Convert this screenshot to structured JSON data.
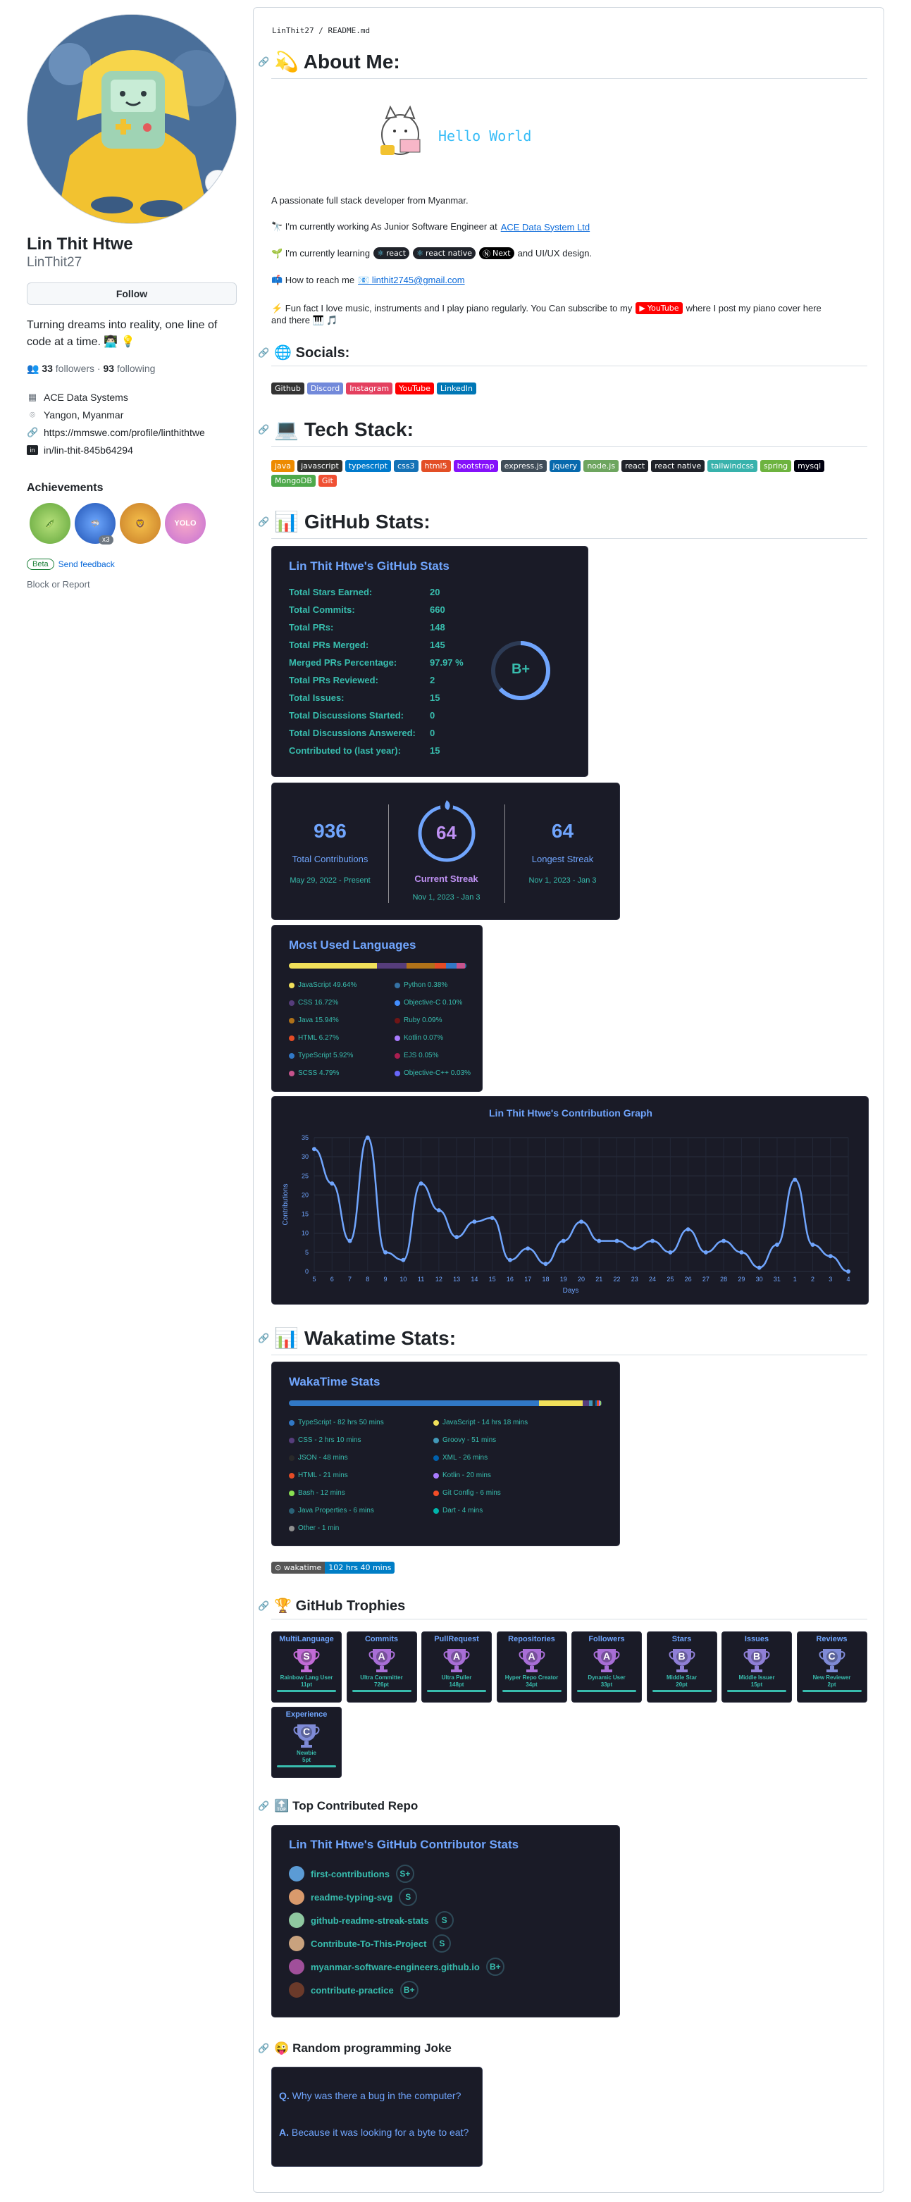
{
  "profile": {
    "name": "Lin Thit Htwe",
    "login": "LinThit27",
    "follow_label": "Follow",
    "bio": "Turning dreams into reality, one line of code at a time. 👨🏻‍💻 💡",
    "followers": "33",
    "followers_label": "followers",
    "following": "93",
    "following_label": "following",
    "company": "ACE Data Systems",
    "location": "Yangon, Myanmar",
    "website": "https://mmswe.com/profile/linthithtwe",
    "linkedin": "in/lin-thit-845b64294",
    "achievements_title": "Achievements",
    "achievement_count": "x3",
    "beta_label": "Beta",
    "feedback_label": "Send feedback",
    "block_label": "Block or Report"
  },
  "readme": {
    "breadcrumb": "LinThit27 / README.md",
    "about_title": "💫 About Me:",
    "hello_world": "Hello World",
    "intro": "A passionate full stack developer from Myanmar.",
    "working_pre": "🔭 I'm currently working As Junior Software Engineer at",
    "working_link": "ACE Data System Ltd",
    "learning_pre": "🌱 I'm currently learning",
    "learning_badges": [
      "react",
      "react native",
      "Next"
    ],
    "learning_post": "and UI/UX design.",
    "reach_pre": "📫 How to reach me",
    "reach_link": "📧 linthit2745@gmail.com",
    "fun_pre": "⚡ Fun fact I love music, instruments and I play piano regularly. You Can subscribe to my",
    "fun_badge": "YouTube",
    "fun_post": "where I post my piano cover here",
    "fun_line2": "and there 🎹 🎵",
    "socials_title": "🌐 Socials:",
    "socials": [
      {
        "label": "Github",
        "color": "#333333"
      },
      {
        "label": "Discord",
        "color": "#7289da"
      },
      {
        "label": "Instagram",
        "color": "#e4405f"
      },
      {
        "label": "YouTube",
        "color": "#ff0000"
      },
      {
        "label": "LinkedIn",
        "color": "#0077b5"
      }
    ],
    "tech_title": "💻 Tech Stack:",
    "tech": [
      {
        "label": "java",
        "color": "#ed8b00"
      },
      {
        "label": "javascript",
        "color": "#323330"
      },
      {
        "label": "typescript",
        "color": "#007acc"
      },
      {
        "label": "css3",
        "color": "#1572b6"
      },
      {
        "label": "html5",
        "color": "#e34f26"
      },
      {
        "label": "bootstrap",
        "color": "#8511fa"
      },
      {
        "label": "express.js",
        "color": "#404d59"
      },
      {
        "label": "jquery",
        "color": "#0769ad"
      },
      {
        "label": "node.js",
        "color": "#6da55f"
      },
      {
        "label": "react",
        "color": "#20232a"
      },
      {
        "label": "react native",
        "color": "#20232a"
      },
      {
        "label": "tailwindcss",
        "color": "#38b2ac"
      },
      {
        "label": "spring",
        "color": "#6db33f"
      },
      {
        "label": "mysql",
        "color": "#00000f"
      },
      {
        "label": "MongoDB",
        "color": "#4ea94b"
      },
      {
        "label": "Git",
        "color": "#f05033"
      }
    ],
    "stats_title": "📊 GitHub Stats:",
    "wakatime_title": "📊 Wakatime Stats:",
    "wakatime_badge_left": "wakatime",
    "wakatime_badge_right": "102 hrs 40 mins",
    "trophies_title": "🏆 GitHub Trophies",
    "top_repo_title": "🔝 Top Contributed Repo",
    "joke_title": "😜 Random programming Joke"
  },
  "github_stats": {
    "title": "Lin Thit Htwe's GitHub Stats",
    "rows": [
      {
        "label": "Total Stars Earned:",
        "value": "20"
      },
      {
        "label": "Total Commits:",
        "value": "660"
      },
      {
        "label": "Total PRs:",
        "value": "148"
      },
      {
        "label": "Total PRs Merged:",
        "value": "145"
      },
      {
        "label": "Merged PRs Percentage:",
        "value": "97.97 %"
      },
      {
        "label": "Total PRs Reviewed:",
        "value": "2"
      },
      {
        "label": "Total Issues:",
        "value": "15"
      },
      {
        "label": "Total Discussions Started:",
        "value": "0"
      },
      {
        "label": "Total Discussions Answered:",
        "value": "0"
      },
      {
        "label": "Contributed to (last year):",
        "value": "15"
      }
    ],
    "rank": "B+"
  },
  "streak": {
    "total": "936",
    "total_label": "Total Contributions",
    "total_range": "May 29, 2022 - Present",
    "current": "64",
    "current_label": "Current Streak",
    "current_range": "Nov 1, 2023 - Jan 3",
    "longest": "64",
    "longest_label": "Longest Streak",
    "longest_range": "Nov 1, 2023 - Jan 3"
  },
  "languages": {
    "title": "Most Used Languages",
    "items": [
      {
        "label": "JavaScript 49.64%",
        "color": "#f1e05a",
        "pct": 49.64
      },
      {
        "label": "CSS 16.72%",
        "color": "#563d7c",
        "pct": 16.72
      },
      {
        "label": "Java 15.94%",
        "color": "#b07219",
        "pct": 15.94
      },
      {
        "label": "HTML 6.27%",
        "color": "#e34c26",
        "pct": 6.27
      },
      {
        "label": "TypeScript 5.92%",
        "color": "#3178c6",
        "pct": 5.92
      },
      {
        "label": "SCSS 4.79%",
        "color": "#c6538c",
        "pct": 4.79
      },
      {
        "label": "Python 0.38%",
        "color": "#3572a5",
        "pct": 0.38
      },
      {
        "label": "Objective-C 0.10%",
        "color": "#438eff",
        "pct": 0.1
      },
      {
        "label": "Ruby 0.09%",
        "color": "#701516",
        "pct": 0.09
      },
      {
        "label": "Kotlin 0.07%",
        "color": "#a97bff",
        "pct": 0.07
      },
      {
        "label": "EJS 0.05%",
        "color": "#a91e50",
        "pct": 0.05
      },
      {
        "label": "Objective-C++ 0.03%",
        "color": "#6866fb",
        "pct": 0.03
      }
    ]
  },
  "chart_data": {
    "type": "line",
    "title": "Lin Thit Htwe's Contribution Graph",
    "xlabel": "Days",
    "ylabel": "Contributions",
    "ylim": [
      0,
      35
    ],
    "yticks": [
      0,
      5,
      10,
      15,
      20,
      25,
      30,
      35
    ],
    "x": [
      "5",
      "6",
      "7",
      "8",
      "9",
      "10",
      "11",
      "12",
      "13",
      "14",
      "15",
      "16",
      "17",
      "18",
      "19",
      "20",
      "21",
      "22",
      "23",
      "24",
      "25",
      "26",
      "27",
      "28",
      "29",
      "30",
      "31",
      "1",
      "2",
      "3",
      "4"
    ],
    "series": [
      {
        "values": [
          32,
          23,
          8,
          35,
          5,
          3,
          23,
          16,
          9,
          13,
          14,
          3,
          6,
          2,
          8,
          13,
          8,
          8,
          6,
          8,
          5,
          11,
          5,
          8,
          5,
          1,
          7,
          24,
          7,
          4,
          0
        ]
      }
    ],
    "grid": true
  },
  "wakatime": {
    "title": "WakaTime Stats",
    "items": [
      {
        "label": "TypeScript - 82 hrs 50 mins",
        "color": "#3178c6",
        "pct": 80
      },
      {
        "label": "JavaScript - 14 hrs 18 mins",
        "color": "#f1e05a",
        "pct": 14
      },
      {
        "label": "CSS - 2 hrs 10 mins",
        "color": "#563d7c",
        "pct": 2
      },
      {
        "label": "Groovy - 51 mins",
        "color": "#4298b8",
        "pct": 1
      },
      {
        "label": "JSON - 48 mins",
        "color": "#292929",
        "pct": 1
      },
      {
        "label": "XML - 26 mins",
        "color": "#0060ac",
        "pct": 0.5
      },
      {
        "label": "HTML - 21 mins",
        "color": "#e34c26",
        "pct": 0.5
      },
      {
        "label": "Kotlin - 20 mins",
        "color": "#a97bff",
        "pct": 0.5
      },
      {
        "label": "Bash - 12 mins",
        "color": "#89e051",
        "pct": 0.2
      },
      {
        "label": "Git Config - 6 mins",
        "color": "#f44d27",
        "pct": 0.1
      },
      {
        "label": "Java Properties - 6 mins",
        "color": "#2a6277",
        "pct": 0.1
      },
      {
        "label": "Dart - 4 mins",
        "color": "#00b4ab",
        "pct": 0.1
      },
      {
        "label": "Other - 1 min",
        "color": "#8f8f8f",
        "pct": 0.05
      }
    ]
  },
  "trophies": [
    {
      "title": "MultiLanguage",
      "rank": "S",
      "label": "Rainbow Lang User",
      "points": "11pt",
      "color": "#c26bd6"
    },
    {
      "title": "Commits",
      "rank": "A",
      "label": "Ultra Committer",
      "points": "726pt",
      "color": "#a86ed6"
    },
    {
      "title": "PullRequest",
      "rank": "A",
      "label": "Ultra Puller",
      "points": "148pt",
      "color": "#a86ed6"
    },
    {
      "title": "Repositories",
      "rank": "A",
      "label": "Hyper Repo Creator",
      "points": "34pt",
      "color": "#a86ed6"
    },
    {
      "title": "Followers",
      "rank": "A",
      "label": "Dynamic User",
      "points": "33pt",
      "color": "#a86ed6"
    },
    {
      "title": "Stars",
      "rank": "B",
      "label": "Middle Star",
      "points": "20pt",
      "color": "#8f7fd6"
    },
    {
      "title": "Issues",
      "rank": "B",
      "label": "Middle Issuer",
      "points": "15pt",
      "color": "#8f7fd6"
    },
    {
      "title": "Reviews",
      "rank": "C",
      "label": "New Reviewer",
      "points": "2pt",
      "color": "#7e8ad6"
    },
    {
      "title": "Experience",
      "rank": "C",
      "label": "Newbie",
      "points": "5pt",
      "color": "#7e8ad6"
    }
  ],
  "contributor": {
    "title": "Lin Thit Htwe's GitHub Contributor Stats",
    "repos": [
      {
        "name": "first-contributions",
        "grade": "S+",
        "avatar": "#5b9bd5"
      },
      {
        "name": "readme-typing-svg",
        "grade": "S",
        "avatar": "#d99a6c"
      },
      {
        "name": "github-readme-streak-stats",
        "grade": "S",
        "avatar": "#8fc8a0"
      },
      {
        "name": "Contribute-To-This-Project",
        "grade": "S",
        "avatar": "#c9a27e"
      },
      {
        "name": "myanmar-software-engineers.github.io",
        "grade": "B+",
        "avatar": "#a04f9a"
      },
      {
        "name": "contribute-practice",
        "grade": "B+",
        "avatar": "#6b3a2a"
      }
    ]
  },
  "joke": {
    "q_prefix": "Q.",
    "q_text": "Why was there a bug in the computer?",
    "a_prefix": "A.",
    "a_text": "Because it was looking for a byte to eat?"
  }
}
